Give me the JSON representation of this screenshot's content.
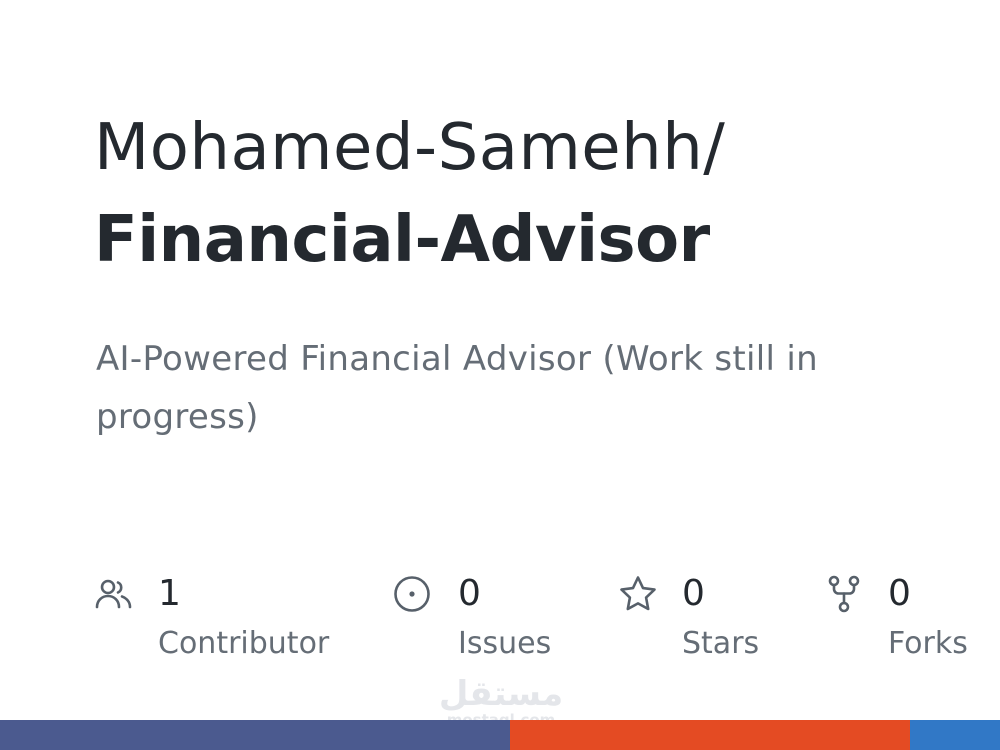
{
  "repo": {
    "owner": "Mohamed-Samehh/",
    "name": "Financial-Advisor",
    "description": "AI-Powered Financial Advisor (Work still in progress)"
  },
  "stats": {
    "contributors": {
      "icon": "people-icon",
      "count": "1",
      "label": "Contributor"
    },
    "issues": {
      "icon": "issue-opened-icon",
      "count": "0",
      "label": "Issues"
    },
    "stars": {
      "icon": "star-icon",
      "count": "0",
      "label": "Stars"
    },
    "forks": {
      "icon": "repo-forked-icon",
      "count": "0",
      "label": "Forks"
    }
  },
  "watermark": {
    "arabic": "مستقل",
    "latin": "mostaql.com"
  },
  "language_bar": {
    "segments": [
      {
        "color": "#4b5a8f",
        "share": 0.51
      },
      {
        "color": "#e44b23",
        "share": 0.4
      },
      {
        "color": "#3178c6",
        "share": 0.09
      }
    ]
  }
}
